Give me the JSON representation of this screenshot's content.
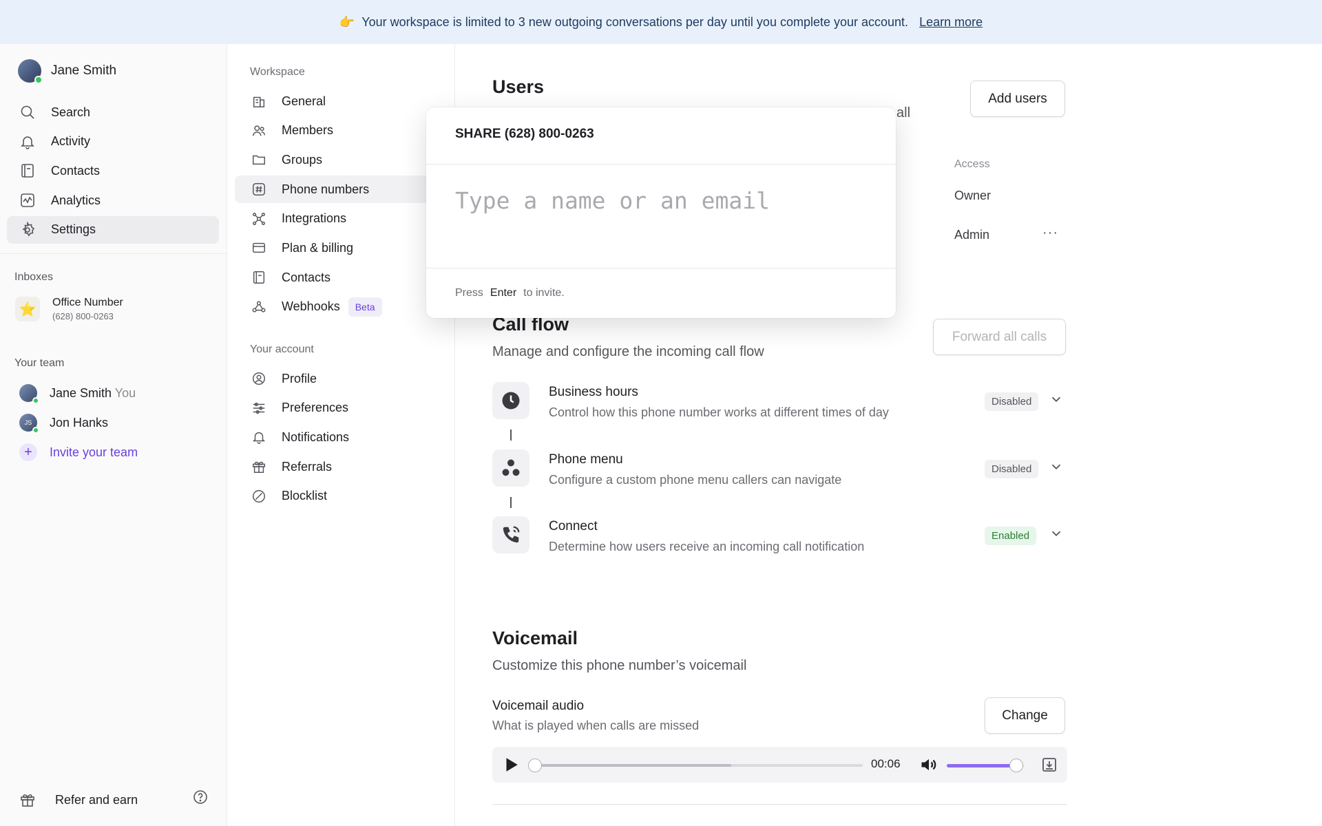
{
  "banner": {
    "emoji": "👉",
    "text": "Your workspace is limited to 3 new outgoing conversations per day until you complete your account.",
    "link": "Learn more"
  },
  "sidebar": {
    "user": {
      "name": "Jane Smith"
    },
    "nav": [
      {
        "label": "Search",
        "icon": "search-icon"
      },
      {
        "label": "Activity",
        "icon": "bell-icon"
      },
      {
        "label": "Contacts",
        "icon": "contacts-icon"
      },
      {
        "label": "Analytics",
        "icon": "analytics-icon"
      },
      {
        "label": "Settings",
        "icon": "gear-icon",
        "active": true
      }
    ],
    "inboxes_heading": "Inboxes",
    "inbox": {
      "name": "Office Number",
      "number": "(628) 800-0263",
      "icon": "⭐"
    },
    "team_heading": "Your team",
    "team": [
      {
        "name": "Jane Smith",
        "suffix": "You"
      },
      {
        "name": "Jon Hanks",
        "initials": "JS"
      }
    ],
    "invite_label": "Invite your team",
    "refer_label": "Refer and earn"
  },
  "settings_nav": {
    "workspace_heading": "Workspace",
    "workspace_items": [
      {
        "label": "General",
        "icon": "building-icon"
      },
      {
        "label": "Members",
        "icon": "members-icon"
      },
      {
        "label": "Groups",
        "icon": "folder-icon"
      },
      {
        "label": "Phone numbers",
        "icon": "hash-icon",
        "active": true
      },
      {
        "label": "Integrations",
        "icon": "integrations-icon"
      },
      {
        "label": "Plan & billing",
        "icon": "card-icon"
      },
      {
        "label": "Contacts",
        "icon": "contacts-icon"
      },
      {
        "label": "Webhooks",
        "icon": "webhook-icon",
        "badge": "Beta"
      }
    ],
    "account_heading": "Your account",
    "account_items": [
      {
        "label": "Profile",
        "icon": "profile-icon"
      },
      {
        "label": "Preferences",
        "icon": "sliders-icon"
      },
      {
        "label": "Notifications",
        "icon": "bell-icon"
      },
      {
        "label": "Referrals",
        "icon": "gift-icon"
      },
      {
        "label": "Blocklist",
        "icon": "block-icon"
      }
    ]
  },
  "main": {
    "users": {
      "title": "Users",
      "subtitle_tail": "all",
      "add_button": "Add users",
      "access_heading": "Access",
      "rows": [
        {
          "access": "Owner"
        },
        {
          "access": "Admin"
        }
      ]
    },
    "call_flow": {
      "title": "Call flow",
      "subtitle": "Manage and configure the incoming call flow",
      "forward_button": "Forward all calls",
      "steps": [
        {
          "title": "Business hours",
          "desc": "Control how this phone number works at different times of day",
          "status": "Disabled"
        },
        {
          "title": "Phone menu",
          "desc": "Configure a custom phone menu callers can navigate",
          "status": "Disabled"
        },
        {
          "title": "Connect",
          "desc": "Determine how users receive an incoming call notification",
          "status": "Enabled"
        }
      ]
    },
    "voicemail": {
      "title": "Voicemail",
      "subtitle": "Customize this phone number’s voicemail",
      "audio_title": "Voicemail audio",
      "audio_desc": "What is played when calls are missed",
      "change_button": "Change",
      "player": {
        "time": "00:06",
        "progress": 0.0,
        "buffered": 0.6,
        "volume": 0.9
      }
    }
  },
  "modal": {
    "title": "SHARE (628) 800-0263",
    "placeholder": "Type a name or an email",
    "footer_press": "Press",
    "footer_key": "Enter",
    "footer_tail": "to invite."
  },
  "colors": {
    "accent": "#6a3fe0",
    "banner_bg": "#e8f1fb",
    "enabled_green": "#2e7d32"
  }
}
